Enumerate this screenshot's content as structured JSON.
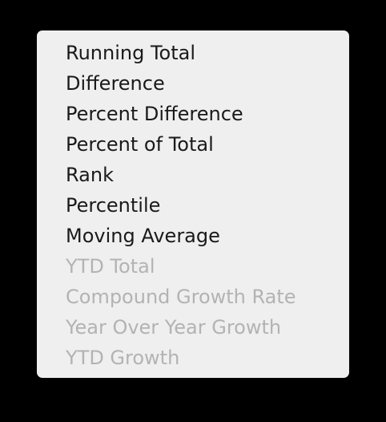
{
  "menu": {
    "items": [
      {
        "label": "Running Total",
        "enabled": true
      },
      {
        "label": "Difference",
        "enabled": true
      },
      {
        "label": "Percent Difference",
        "enabled": true
      },
      {
        "label": "Percent of Total",
        "enabled": true
      },
      {
        "label": "Rank",
        "enabled": true
      },
      {
        "label": "Percentile",
        "enabled": true
      },
      {
        "label": "Moving Average",
        "enabled": true
      },
      {
        "label": "YTD Total",
        "enabled": false
      },
      {
        "label": "Compound Growth Rate",
        "enabled": false
      },
      {
        "label": "Year Over Year Growth",
        "enabled": false
      },
      {
        "label": "YTD Growth",
        "enabled": false
      }
    ]
  },
  "colors": {
    "background": "#000000",
    "menu_background": "#efefef",
    "enabled_text": "#1a1a1a",
    "disabled_text": "#b3b3b3"
  }
}
